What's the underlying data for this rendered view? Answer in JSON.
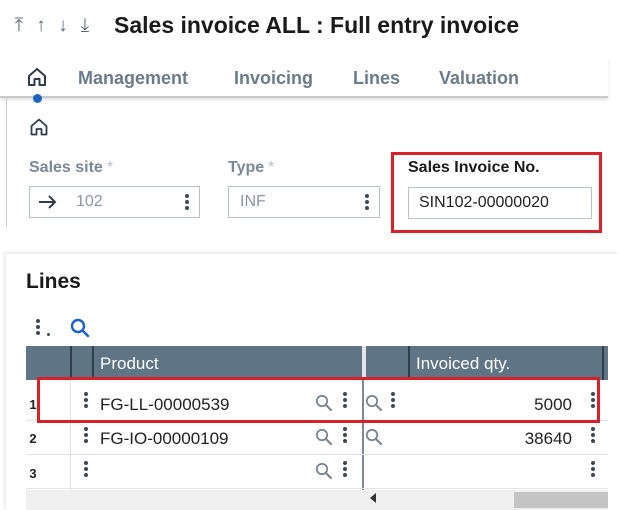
{
  "header": {
    "nav": [
      "first-record",
      "previous-record",
      "next-record",
      "last-record"
    ],
    "title": "Sales invoice ALL : Full entry invoice"
  },
  "tabs": [
    {
      "label": "Management"
    },
    {
      "label": "Invoicing"
    },
    {
      "label": "Lines"
    },
    {
      "label": "Valuation"
    }
  ],
  "form": {
    "sales_site": {
      "label": "Sales site",
      "value": "102"
    },
    "type": {
      "label": "Type",
      "value": "INF"
    },
    "invoice_no": {
      "label": "Sales Invoice No.",
      "value": "SIN102-00000020"
    },
    "required_mark": "*"
  },
  "lines": {
    "title": "Lines",
    "columns": {
      "product": "Product",
      "invoiced_qty": "Invoiced qty."
    },
    "rows": [
      {
        "num": "1",
        "product": "FG-LL-00000539",
        "qty": "5000"
      },
      {
        "num": "2",
        "product": "FG-IO-00000109",
        "qty": "38640"
      },
      {
        "num": "3",
        "product": "",
        "qty": ""
      }
    ]
  },
  "colors": {
    "accent": "#1c62c4",
    "highlight": "#d6202a",
    "grid_header": "#5f7585"
  }
}
